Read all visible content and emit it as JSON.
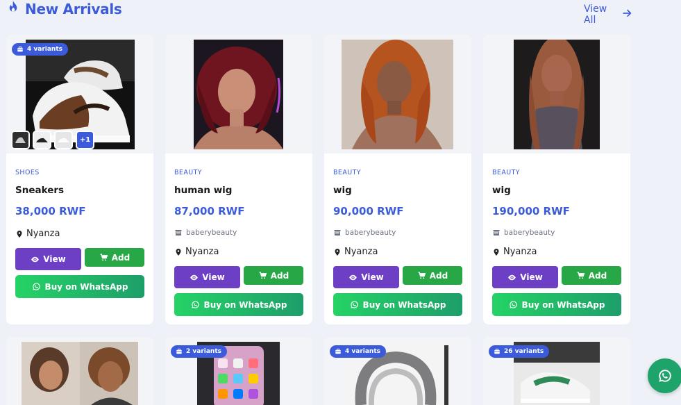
{
  "section": {
    "title": "New Arrivals",
    "view_all": "View All"
  },
  "products": [
    {
      "category": "SHOES",
      "name": "Sneakers",
      "price": "38,000 RWF",
      "seller": "",
      "location": "Nyanza",
      "variants": "4 variants",
      "more_thumbs": "+1"
    },
    {
      "category": "BEAUTY",
      "name": "human wig",
      "price": "87,000 RWF",
      "seller": "baberybeauty",
      "location": "Nyanza"
    },
    {
      "category": "BEAUTY",
      "name": "wig",
      "price": "90,000 RWF",
      "seller": "baberybeauty",
      "location": "Nyanza"
    },
    {
      "category": "BEAUTY",
      "name": "wig",
      "price": "190,000 RWF",
      "seller": "baberybeauty",
      "location": "Nyanza"
    }
  ],
  "buttons": {
    "view": "View",
    "add": "Add",
    "whatsapp": "Buy on WhatsApp"
  },
  "second_row_badges": [
    "2 variants",
    "4 variants",
    "26 variants"
  ],
  "icons": {
    "title": "fire-icon",
    "view_all": "arrow-right-icon",
    "location": "map-marker-icon",
    "seller": "store-icon",
    "view": "eye-icon",
    "add": "cart-icon",
    "whatsapp": "whatsapp-icon",
    "badge": "box-icon"
  },
  "colors": {
    "accent": "#3b5bdb",
    "view_button": "#6c3fc5",
    "add_button": "#27a745",
    "whatsapp_start": "#25d366",
    "whatsapp_end": "#1e9e6a"
  }
}
